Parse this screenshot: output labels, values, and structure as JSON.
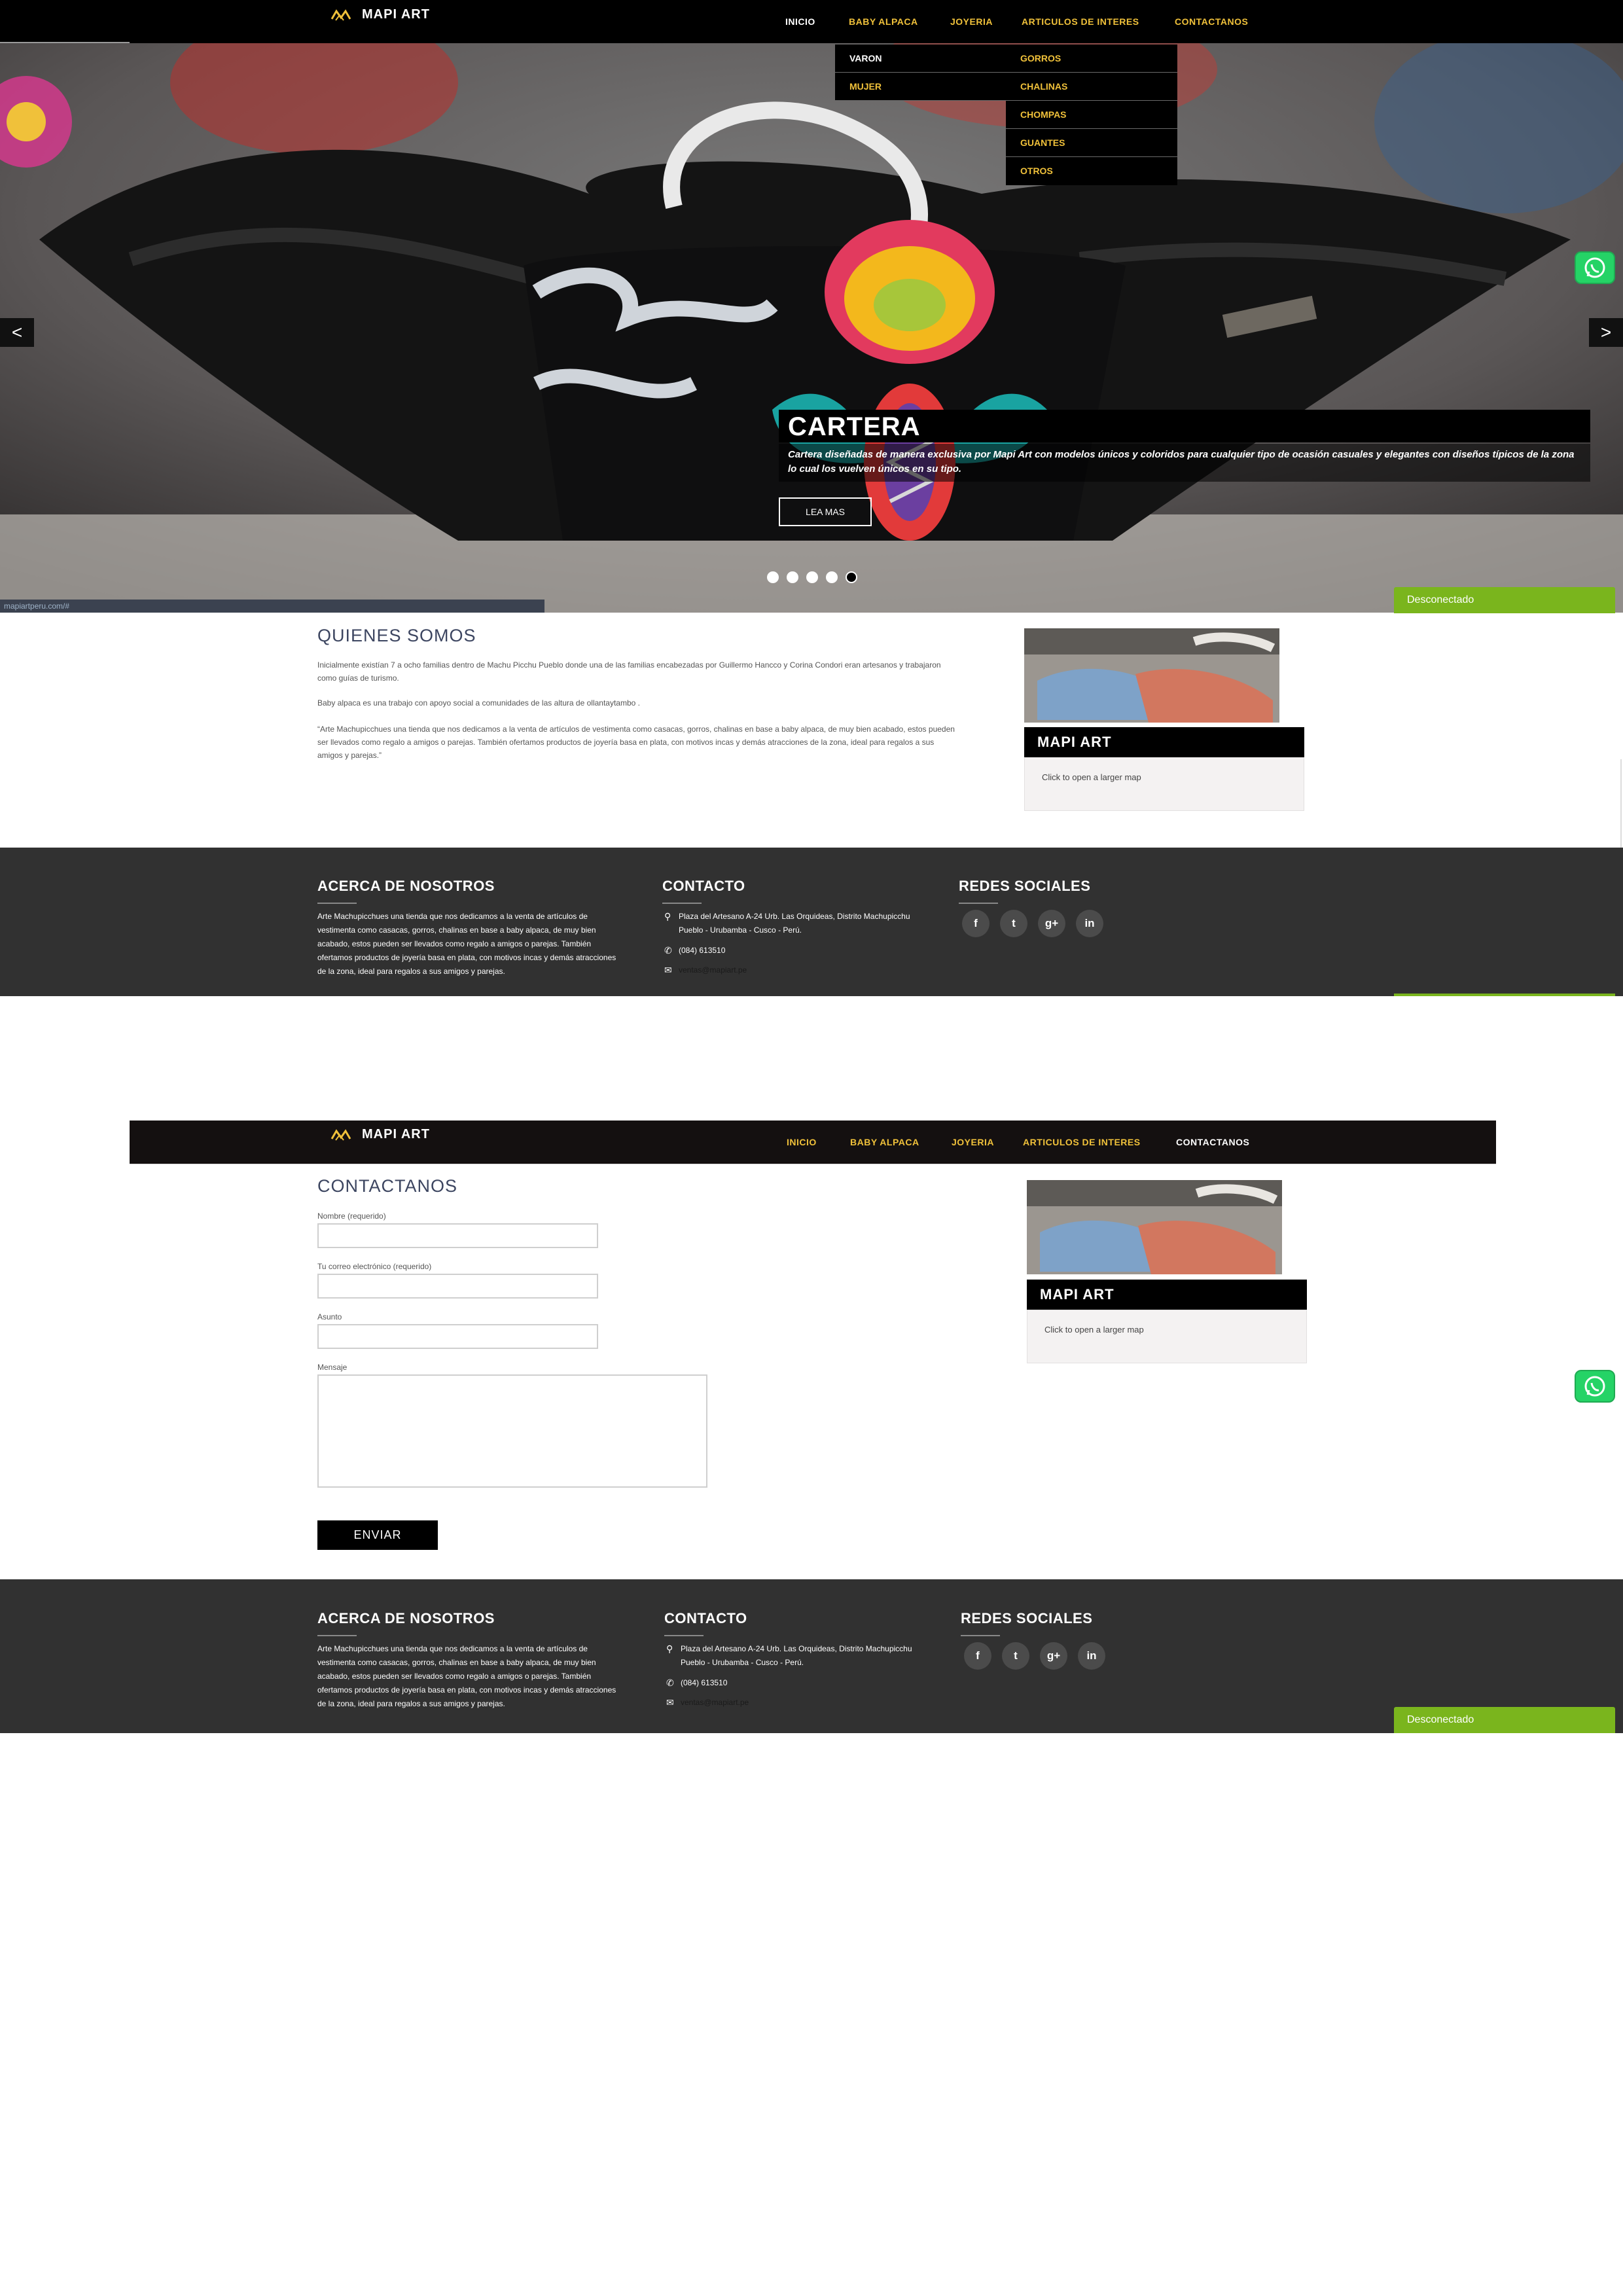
{
  "brand": {
    "name": "MAPI ART"
  },
  "nav": {
    "items": [
      {
        "label": "INICIO"
      },
      {
        "label": "BABY ALPACA"
      },
      {
        "label": "JOYERIA"
      },
      {
        "label": "ARTICULOS DE INTERES"
      },
      {
        "label": "CONTACTANOS"
      }
    ]
  },
  "dropdown_alpaca": [
    {
      "label": "VARON"
    },
    {
      "label": "MUJER"
    }
  ],
  "dropdown_interes": [
    {
      "label": "GORROS"
    },
    {
      "label": "CHALINAS"
    },
    {
      "label": "CHOMPAS"
    },
    {
      "label": "GUANTES"
    },
    {
      "label": "OTROS"
    }
  ],
  "hero": {
    "title": "CARTERA",
    "text": "Cartera diseñadas de manera exclusiva por Mapi Art con modelos únicos y coloridos para cualquier tipo de ocasión casuales y elegantes con diseños típicos de la zona lo cual los vuelven únicos en su tipo.",
    "button": "LEA MAS",
    "prev_icon": "<",
    "next_icon": ">",
    "dots_total": 5,
    "dots_active": 5,
    "status_url": "mapiartperu.com/#"
  },
  "about": {
    "title": "QUIENES SOMOS",
    "p1": "Inicialmente existían 7 a ocho familias dentro de Machu Picchu Pueblo donde una de las familias encabezadas por Guillermo Hancco y Corina Condori eran artesanos y trabajaron como guías de turismo.",
    "p2": "Baby alpaca es una trabajo con apoyo social a comunidades de las altura de ollantaytambo .",
    "p3": "“Arte Machupicchues una tienda que nos dedicamos a la venta de artículos de vestimenta como casacas, gorros, chalinas en base a baby alpaca, de muy bien acabado, estos pueden ser llevados como regalo a amigos o parejas. También ofertamos productos de joyería basa en plata, con motivos incas y demás atracciones de la zona, ideal para regalos a sus amigos y parejas.”"
  },
  "sidebar": {
    "title": "MAPI ART",
    "map_text": "Click to open a larger map"
  },
  "footer": {
    "about_title": "ACERCA DE NOSOTROS",
    "about_text": "Arte Machupicchues una tienda que nos dedicamos a la venta de artículos de vestimenta como casacas, gorros, chalinas en base a baby alpaca, de muy bien acabado, estos pueden ser llevados como regalo a amigos o parejas. También ofertamos productos de joyería basa en plata, con motivos incas y demás atracciones de la zona, ideal para regalos a sus amigos y parejas.",
    "contact_title": "CONTACTO",
    "address": "Plaza del Artesano A-24 Urb. Las Orquideas, Distrito Machupicchu Pueblo - Urubamba - Cusco - Perú.",
    "phone": "(084) 613510",
    "email": "ventas@mapiart.pe",
    "social_title": "REDES SOCIALES",
    "social": [
      {
        "label": "f"
      },
      {
        "label": "t"
      },
      {
        "label": "g+"
      },
      {
        "label": "in"
      }
    ]
  },
  "contact": {
    "title": "CONTACTANOS",
    "name_label": "Nombre (requerido)",
    "email_label": "Tu correo electrónico (requerido)",
    "subject_label": "Asunto",
    "message_label": "Mensaje",
    "submit": "ENVIAR"
  },
  "chat": {
    "status": "Desconectado"
  },
  "colors": {
    "gold": "#f0c13a",
    "green": "#7ab51d",
    "footer_bg": "#313131",
    "whatsapp": "#25d366"
  }
}
